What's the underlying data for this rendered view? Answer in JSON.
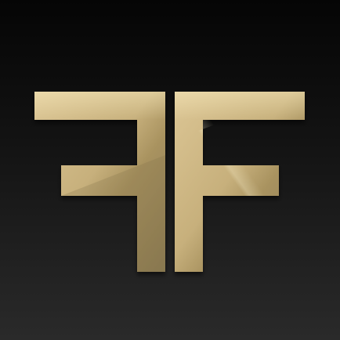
{
  "app_icon": {
    "name": "FF",
    "background_color_top": "#050505",
    "background_color_bottom": "#2a2a2a",
    "logo_color_light": "#d8c28f",
    "logo_color_mid": "#b8a36f",
    "logo_color_dark": "#8f7d54",
    "logo_shadow_color": "#000000"
  }
}
